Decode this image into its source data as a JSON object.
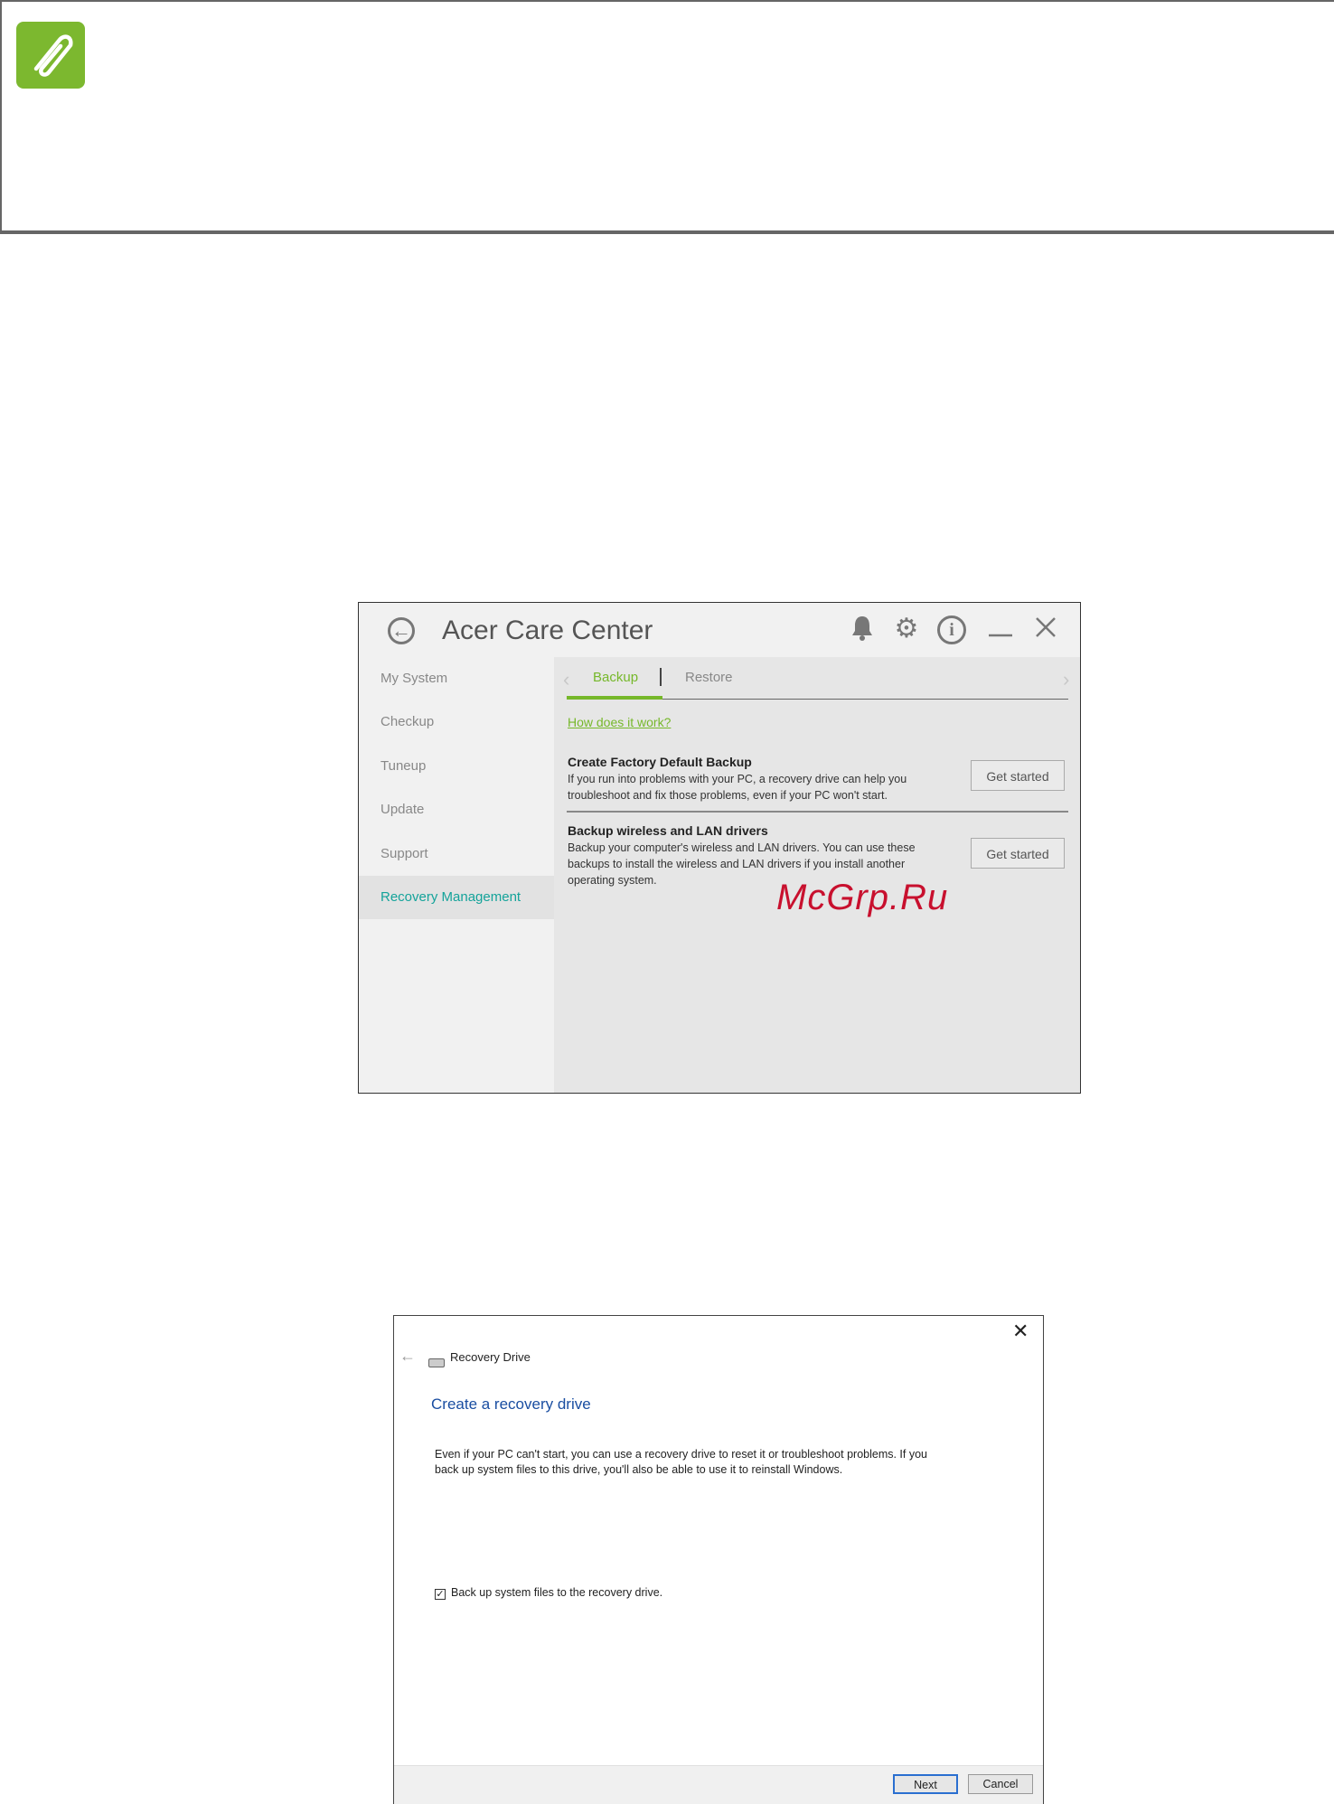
{
  "note": {
    "icon": "paperclip-icon",
    "accent": "#7cb82f"
  },
  "acc": {
    "title": "Acer Care Center",
    "sidebar": [
      {
        "label": "My System"
      },
      {
        "label": "Checkup"
      },
      {
        "label": "Tuneup"
      },
      {
        "label": "Update"
      },
      {
        "label": "Support"
      },
      {
        "label": "Recovery Management",
        "active": true
      }
    ],
    "tabs": {
      "backup": "Backup",
      "restore": "Restore"
    },
    "link": "How does it work?",
    "options": [
      {
        "title": "Create Factory Default Backup",
        "desc": "If you run into problems with your PC, a recovery drive can help you troubleshoot and fix those problems, even if your PC won't start.",
        "button": "Get started"
      },
      {
        "title": "Backup wireless and LAN drivers",
        "desc": "Backup your computer's wireless and LAN drivers. You can use these backups to install the wireless and LAN drivers if you install another operating system.",
        "button": "Get started"
      }
    ],
    "accent": "#76b82a",
    "active_color": "#14a39a"
  },
  "watermark": "McGrp.Ru",
  "recovery": {
    "window_title": "Recovery Drive",
    "heading": "Create a recovery drive",
    "body": "Even if your PC can't start, you can use a recovery drive to reset it or troubleshoot problems. If you back up system files to this drive, you'll also be able to use it to reinstall Windows.",
    "checkbox_label": "Back up system files to the recovery drive.",
    "checkbox_checked": true,
    "next_label": "Next",
    "cancel_label": "Cancel",
    "heading_color": "#1a4ea1"
  }
}
